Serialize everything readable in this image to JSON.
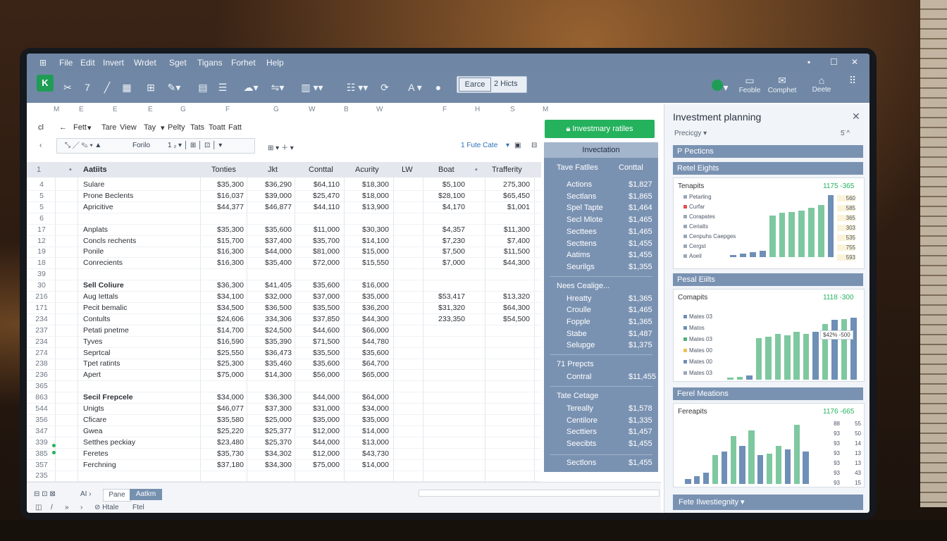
{
  "menu": [
    "File",
    "Edit",
    "Invert",
    "Wrdet",
    "Sget",
    "Tigans",
    "Forhet",
    "Help"
  ],
  "toolbar": {
    "app_letter": "K",
    "search_button": "Earce",
    "search_text": "2 Hicts",
    "right_tools": [
      {
        "icon": "dashboard",
        "label": "Feoble"
      },
      {
        "icon": "chat",
        "label": "Comphet"
      },
      {
        "icon": "share",
        "label": "Deete"
      }
    ]
  },
  "column_letters": [
    "M",
    "E",
    "E",
    "E",
    "G",
    "F",
    "G",
    "W",
    "B",
    "W",
    "F",
    "H",
    "S",
    "M"
  ],
  "formula_row1": [
    "cl",
    "←",
    "Fett",
    "▾",
    "Tare",
    "View",
    "Tay",
    "▾",
    "Pelty",
    "Tats",
    "Toatt",
    "Fatt"
  ],
  "formula_row2": {
    "name_box": "Forilo",
    "right_text": "1 Fute Cate"
  },
  "table": {
    "headers": [
      "Aatiits",
      "Tonties",
      "Jkt",
      "Conttal",
      "Acurity",
      "LW",
      "Boat",
      "Trafferity"
    ],
    "rows": [
      {
        "rn": "4",
        "label": "Sulare",
        "bold": false,
        "vals": [
          "$35,300",
          "$36,290",
          "$64,110",
          "$18,300",
          "$5,100",
          "275,300"
        ]
      },
      {
        "rn": "5",
        "label": "Prone Beclents",
        "bold": false,
        "vals": [
          "$16,037",
          "$39,000",
          "$25,470",
          "$18,000",
          "$28,100",
          "$65,450"
        ]
      },
      {
        "rn": "5",
        "label": "Apricitive",
        "bold": false,
        "vals": [
          "$44,377",
          "$46,877",
          "$44,110",
          "$13,900",
          "$4,170",
          "$1,001"
        ]
      },
      {
        "rn": "6",
        "label": "",
        "bold": false,
        "vals": [
          "",
          "",
          "",
          "",
          "",
          ""
        ]
      },
      {
        "rn": "17",
        "label": "Anplats",
        "bold": false,
        "vals": [
          "$35,300",
          "$35,600",
          "$11,000",
          "$30,300",
          "$4,357",
          "$11,300"
        ]
      },
      {
        "rn": "12",
        "label": "Concls rechents",
        "bold": false,
        "vals": [
          "$15,700",
          "$37,400",
          "$35,700",
          "$14,100",
          "$7,230",
          "$7,400"
        ]
      },
      {
        "rn": "19",
        "label": "Ponile",
        "bold": false,
        "vals": [
          "$16,300",
          "$44,000",
          "$81,000",
          "$15,000",
          "$7,500",
          "$11,500"
        ]
      },
      {
        "rn": "18",
        "label": "Conrecients",
        "bold": false,
        "vals": [
          "$16,300",
          "$35,400",
          "$72,000",
          "$15,550",
          "$7,000",
          "$44,300"
        ]
      },
      {
        "rn": "39",
        "label": "",
        "bold": false,
        "vals": [
          "",
          "",
          "",
          "",
          "",
          ""
        ]
      },
      {
        "rn": "30",
        "label": "Sell Coliure",
        "bold": true,
        "vals": [
          "$36,300",
          "$41,405",
          "$35,600",
          "$16,000",
          "",
          ""
        ]
      },
      {
        "rn": "216",
        "label": "Aug Iettals",
        "bold": false,
        "vals": [
          "$34,100",
          "$32,000",
          "$37,000",
          "$35,000",
          "$53,417",
          "$13,320"
        ]
      },
      {
        "rn": "171",
        "label": "Pecit bemalic",
        "bold": false,
        "vals": [
          "$34,500",
          "$36,500",
          "$35,500",
          "$36,200",
          "$31,320",
          "$64,300"
        ]
      },
      {
        "rn": "234",
        "label": "Contults",
        "bold": false,
        "vals": [
          "$24,606",
          "334,306",
          "$37,850",
          "$44,300",
          "233,350",
          "$54,500"
        ]
      },
      {
        "rn": "237",
        "label": "Petati pnetme",
        "bold": false,
        "vals": [
          "$14,700",
          "$24,500",
          "$44,600",
          "$66,000",
          "",
          ""
        ]
      },
      {
        "rn": "234",
        "label": "Tyves",
        "bold": false,
        "vals": [
          "$16,590",
          "$35,390",
          "$71,500",
          "$44,780",
          "",
          ""
        ]
      },
      {
        "rn": "274",
        "label": "Seprtcal",
        "bold": false,
        "vals": [
          "$25,550",
          "$36,473",
          "$35,500",
          "$35,600",
          "",
          ""
        ]
      },
      {
        "rn": "238",
        "label": "Tpet ratints",
        "bold": false,
        "vals": [
          "$25,300",
          "$35,460",
          "$35,600",
          "$64,700",
          "",
          ""
        ]
      },
      {
        "rn": "236",
        "label": "Apert",
        "bold": false,
        "vals": [
          "$75,000",
          "$14,300",
          "$56,000",
          "$65,000",
          "",
          ""
        ]
      },
      {
        "rn": "365",
        "label": "",
        "bold": false,
        "vals": [
          "",
          "",
          "",
          "",
          "",
          ""
        ]
      },
      {
        "rn": "863",
        "label": "Secil Frepcele",
        "bold": true,
        "vals": [
          "$34,000",
          "$36,300",
          "$44,000",
          "$64,000",
          "",
          ""
        ]
      },
      {
        "rn": "544",
        "label": "Unigts",
        "bold": false,
        "vals": [
          "$46,077",
          "$37,300",
          "$31,000",
          "$34,000",
          "",
          ""
        ]
      },
      {
        "rn": "356",
        "label": "Cficare",
        "bold": false,
        "vals": [
          "$35,580",
          "$25,000",
          "$35,000",
          "$35,000",
          "",
          ""
        ]
      },
      {
        "rn": "347",
        "label": "Gwea",
        "bold": false,
        "vals": [
          "$25,220",
          "$25,377",
          "$12,000",
          "$14,000",
          "",
          ""
        ]
      },
      {
        "rn": "339",
        "label": "Setthes peckiay",
        "bold": false,
        "vals": [
          "$23,480",
          "$25,370",
          "$44,000",
          "$13,000",
          "",
          ""
        ]
      },
      {
        "rn": "385",
        "label": "Feretes",
        "bold": false,
        "vals": [
          "$35,730",
          "$34,302",
          "$12,000",
          "$43,730",
          "",
          ""
        ]
      },
      {
        "rn": "357",
        "label": "Ferchning",
        "bold": false,
        "vals": [
          "$37,180",
          "$34,300",
          "$75,000",
          "$14,000",
          "",
          ""
        ]
      },
      {
        "rn": "235",
        "label": "",
        "bold": false,
        "vals": [
          "",
          "",
          "",
          "",
          "",
          ""
        ]
      }
    ]
  },
  "statusbar": {
    "tabs": [
      "Pane",
      "Aatkm"
    ],
    "left": "AI ›",
    "bottom": [
      "◫",
      "/",
      "»",
      "›",
      "⊘ Htale",
      "Ftel"
    ]
  },
  "summary": {
    "button": "Investmary ratiles",
    "header": "Invectation",
    "col_left": "Tave Fatlles",
    "col_right": "Conttal",
    "group1": [
      {
        "label": "Actions",
        "value": "$1,827"
      },
      {
        "label": "Sectlans",
        "value": "$1,865"
      },
      {
        "label": "Spel Tapte",
        "value": "$1,464"
      },
      {
        "label": "Secl Mlote",
        "value": "$1,465"
      },
      {
        "label": "Secttees",
        "value": "$1,465"
      },
      {
        "label": "Secttens",
        "value": "$1,455"
      },
      {
        "label": "Aatims",
        "value": "$1,455"
      },
      {
        "label": "Seurilgs",
        "value": "$1,355"
      }
    ],
    "group2_title": "Nees Cealige...",
    "group2": [
      {
        "label": "Hreatty",
        "value": "$1,365"
      },
      {
        "label": "Croulle",
        "value": "$1,465"
      },
      {
        "label": "Fopple",
        "value": "$1,365"
      },
      {
        "label": "Stabe",
        "value": "$1,487"
      },
      {
        "label": "Selupge",
        "value": "$1,375"
      }
    ],
    "group3_title": "71 Prepcts",
    "group3": [
      {
        "label": "Contral",
        "value": "$11,455"
      }
    ],
    "group4_title": "Tate Cetage",
    "group4": [
      {
        "label": "Tereally",
        "value": "$1,578"
      },
      {
        "label": "Centilore",
        "value": "$1,335"
      },
      {
        "label": "Secttiers",
        "value": "$1,457"
      },
      {
        "label": "Seecibts",
        "value": "$1,455"
      }
    ],
    "footer": {
      "label": "Sectlons",
      "value": "$1,455"
    }
  },
  "right_panel": {
    "title": "Investment planning",
    "sub_left": "Precicgy ▾",
    "sub_right": "5̈  ^",
    "section1": "P Pecticns",
    "section2": "Retel Eights",
    "card1": {
      "title": "Tenapits",
      "value": "1175 -365",
      "legend": [
        {
          "label": "Petarling",
          "color": "#9aa7b8"
        },
        {
          "label": "Curfar",
          "color": "#e05050"
        },
        {
          "label": "Corapates",
          "color": "#9aa7b8"
        },
        {
          "label": "Cerialts",
          "color": "#9aa7b8"
        },
        {
          "label": "Cenpuhs Caepges",
          "color": "#9aa7b8"
        },
        {
          "label": "Cergst",
          "color": "#9aa7b8"
        },
        {
          "label": "Aoeil",
          "color": "#9aa7b8"
        }
      ],
      "bars": [
        3,
        5,
        6,
        8,
        54,
        57,
        58,
        60,
        64,
        67,
        80
      ],
      "bar_colors": [
        "#6e8fb6",
        "#6e8fb6",
        "#6e8fb6",
        "#6e8fb6",
        "#7ec8a0",
        "#7ec8a0",
        "#7ec8a0",
        "#7ec8a0",
        "#7ec8a0",
        "#7ec8a0",
        "#6e8fb6"
      ],
      "nums": [
        "560",
        "585",
        "365",
        "303",
        "535",
        "755",
        "593"
      ]
    },
    "section3": "Pesal Eiilts",
    "card2": {
      "title": "Comapits",
      "value": "1118 -300",
      "legend": [
        {
          "label": "Mates 03",
          "color": "#6e8fb6"
        },
        {
          "label": "Matos",
          "color": "#6e8fb6"
        },
        {
          "label": "Mates 03",
          "color": "#4fb07a"
        },
        {
          "label": "Mates 00",
          "color": "#f0c060"
        },
        {
          "label": "Mates 00",
          "color": "#6e8fb6"
        },
        {
          "label": "Mates 03",
          "color": "#9aa7b8"
        }
      ],
      "bars": [
        3,
        4,
        5,
        52,
        54,
        58,
        56,
        60,
        58,
        60,
        70,
        75,
        76,
        78
      ],
      "bar_colors": [
        "#7ec8a0",
        "#7ec8a0",
        "#6e8fb6",
        "#7ec8a0",
        "#7ec8a0",
        "#7ec8a0",
        "#7ec8a0",
        "#7ec8a0",
        "#7ec8a0",
        "#6e8fb6",
        "#7ec8a0",
        "#6e8fb6",
        "#7ec8a0",
        "#6e8fb6"
      ],
      "badge": "$42% -500"
    },
    "section4": "Ferel Meations",
    "card3": {
      "title": "Fereapits",
      "value": "1176 -665",
      "bars": [
        5,
        8,
        12,
        30,
        34,
        50,
        40,
        56,
        30,
        32,
        40,
        36,
        62,
        34
      ],
      "bar_colors": [
        "#6e8fb6",
        "#6e8fb6",
        "#6e8fb6",
        "#7ec8a0",
        "#6e8fb6",
        "#7ec8a0",
        "#6e8fb6",
        "#7ec8a0",
        "#6e8fb6",
        "#7ec8a0",
        "#7ec8a0",
        "#6e8fb6",
        "#7ec8a0",
        "#6e8fb6"
      ],
      "nums": [
        "55",
        "50",
        "14",
        "13",
        "13",
        "43",
        "15"
      ],
      "nums_left": [
        "88",
        "93",
        "93",
        "93",
        "93",
        "93",
        "93"
      ]
    },
    "footer": "Fete Ilwestiegnity ▾"
  }
}
